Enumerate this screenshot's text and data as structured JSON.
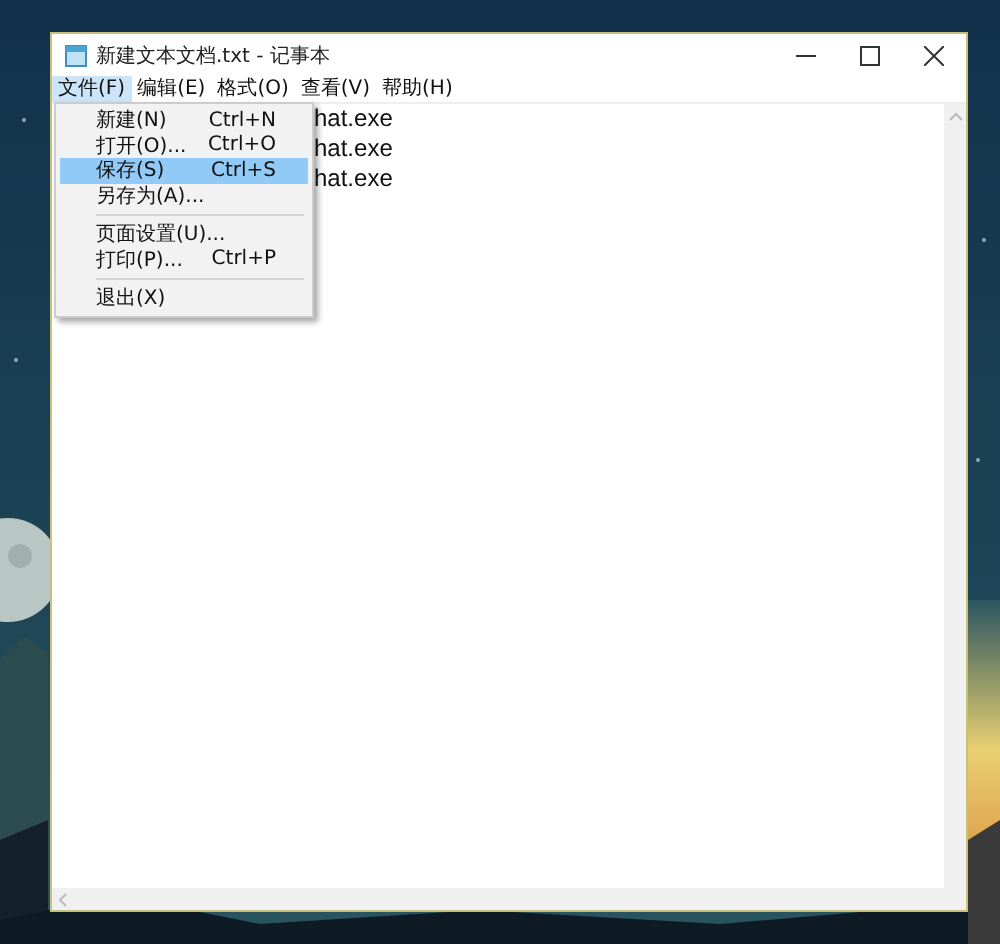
{
  "window": {
    "title": "新建文本文档.txt - 记事本"
  },
  "menu_bar": [
    {
      "label": "文件(F)",
      "selected": true
    },
    {
      "label": "编辑(E)",
      "selected": false
    },
    {
      "label": "格式(O)",
      "selected": false
    },
    {
      "label": "查看(V)",
      "selected": false
    },
    {
      "label": "帮助(H)",
      "selected": false
    }
  ],
  "file_menu": [
    {
      "kind": "item",
      "label": "新建(N)",
      "shortcut": "Ctrl+N",
      "selected": false
    },
    {
      "kind": "item",
      "label": "打开(O)...",
      "shortcut": "Ctrl+O",
      "selected": false
    },
    {
      "kind": "item",
      "label": "保存(S)",
      "shortcut": "Ctrl+S",
      "selected": true
    },
    {
      "kind": "item",
      "label": "另存为(A)...",
      "selected": false
    },
    {
      "kind": "separator"
    },
    {
      "kind": "item",
      "label": "页面设置(U)...",
      "selected": false
    },
    {
      "kind": "item",
      "label": "打印(P)...",
      "shortcut": "Ctrl+P",
      "selected": false
    },
    {
      "kind": "separator"
    },
    {
      "kind": "item",
      "label": "退出(X)",
      "selected": false
    }
  ],
  "editor": {
    "lines": [
      "hat.exe",
      "hat.exe",
      "hat.exe"
    ]
  }
}
